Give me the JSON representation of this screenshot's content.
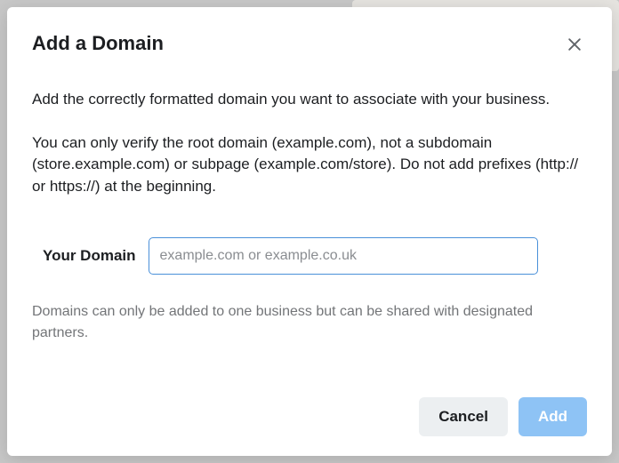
{
  "modal": {
    "title": "Add a Domain",
    "description": "Add the correctly formatted domain you want to associate with your business.",
    "constraint": "You can only verify the root domain (example.com), not a subdomain (store.example.com) or subpage (example.com/store). Do not add prefixes (http:// or https://) at the beginning.",
    "form": {
      "label": "Your Domain",
      "placeholder": "example.com or example.co.uk",
      "value": ""
    },
    "helper": "Domains can only be added to one business but can be shared with designated partners.",
    "buttons": {
      "cancel": "Cancel",
      "add": "Add"
    }
  }
}
